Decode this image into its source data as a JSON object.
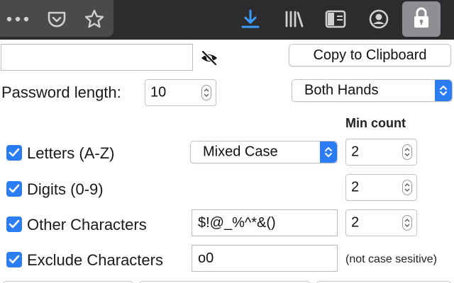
{
  "toolbar": {
    "icons": [
      {
        "name": "more-icon"
      },
      {
        "name": "pocket-icon"
      },
      {
        "name": "bookmark-star-icon"
      },
      {
        "name": "download-icon",
        "color": "#3d9cff"
      },
      {
        "name": "library-icon"
      },
      {
        "name": "sidebar-icon"
      },
      {
        "name": "account-icon"
      },
      {
        "name": "lock-icon"
      }
    ]
  },
  "panel": {
    "password": {
      "value": "",
      "placeholder": ""
    },
    "visibility_icon": "eye-slash-icon",
    "copy_button": "Copy to Clipboard",
    "length": {
      "label": "Password length:",
      "value": "10"
    },
    "hands_select": {
      "selected": "Both Hands"
    },
    "min_count_header": "Min count",
    "rows": [
      {
        "label": "Letters (A-Z)",
        "checked": true,
        "case_select": "Mixed Case",
        "count": "2"
      },
      {
        "label": "Digits (0-9)",
        "checked": true,
        "count": "2"
      },
      {
        "label": "Other Characters",
        "checked": true,
        "chars": "$!@_%^*&()",
        "count": "2"
      },
      {
        "label": "Exclude Characters",
        "checked": true,
        "chars": "o0",
        "note": "(not case sesitive)"
      }
    ]
  },
  "colors": {
    "accent": "#2a7df4",
    "toolbar_bg": "#2c2c2e",
    "download": "#3d9cff"
  }
}
